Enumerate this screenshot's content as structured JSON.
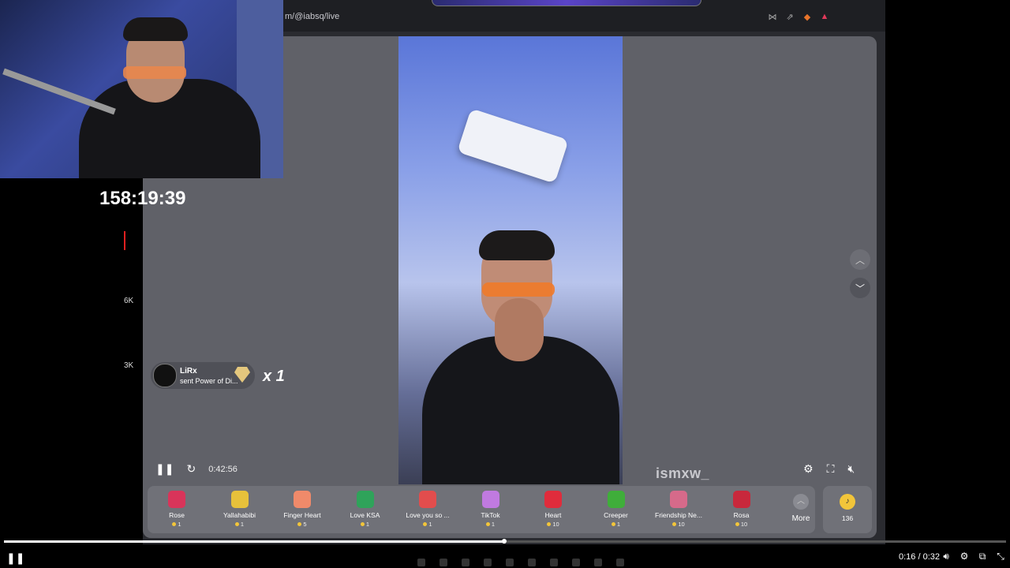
{
  "browser": {
    "url": "m/@iabsq/live"
  },
  "stream_overlay": {
    "timer": "158:19:39",
    "axis_labels": [
      "6K",
      "3K"
    ]
  },
  "live": {
    "gift_notice": {
      "user": "LiRx",
      "message": "sent Power of Di...",
      "combo": "x 1"
    },
    "player": {
      "elapsed": "0:42:56",
      "watermark": "ismxw_"
    },
    "gifts": [
      {
        "name": "Rose",
        "price": "1",
        "color": "#d9345a"
      },
      {
        "name": "Yallahabibi",
        "price": "1",
        "color": "#e7c13b"
      },
      {
        "name": "Finger Heart",
        "price": "5",
        "color": "#f08a6a"
      },
      {
        "name": "Love KSA",
        "price": "1",
        "color": "#2fa35a"
      },
      {
        "name": "Love you so ...",
        "price": "1",
        "color": "#e24d4d"
      },
      {
        "name": "TikTok",
        "price": "1",
        "color": "#c07ae0"
      },
      {
        "name": "Heart",
        "price": "10",
        "color": "#e02c3c"
      },
      {
        "name": "Creeper",
        "price": "1",
        "color": "#3fae3a"
      },
      {
        "name": "Friendship Ne...",
        "price": "10",
        "color": "#d66a8a"
      },
      {
        "name": "Rosa",
        "price": "10",
        "color": "#c8283c"
      }
    ],
    "more_label": "More",
    "coins": "136"
  },
  "player_bar": {
    "time": "0:16 / 0:32",
    "progress": 0.5
  }
}
